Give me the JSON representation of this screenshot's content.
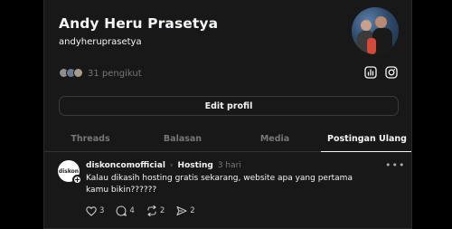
{
  "profile": {
    "name": "Andy Heru Prasetya",
    "handle": "andyheruprasetya",
    "followers_text": "31 pengikut"
  },
  "actions": {
    "edit_profile": "Edit profil"
  },
  "tabs": [
    {
      "label": "Threads",
      "active": false
    },
    {
      "label": "Balasan",
      "active": false
    },
    {
      "label": "Media",
      "active": false
    },
    {
      "label": "Postingan Ulang",
      "active": true
    }
  ],
  "post": {
    "avatar_text": "diskon",
    "username": "diskoncomofficial",
    "topic": "Hosting",
    "time": "3 hari",
    "text": "Kalau dikasih hosting gratis sekarang, website apa yang pertama kamu bikin??????",
    "likes": "3",
    "comments": "4",
    "reposts": "2",
    "shares": "2"
  },
  "icons": {
    "insights": "bar-chart-icon",
    "instagram": "instagram-icon",
    "more": "more-horizontal-icon",
    "like": "heart-icon",
    "comment": "comment-icon",
    "repost": "repost-icon",
    "share": "send-icon"
  },
  "colors": {
    "background": "#000000",
    "card": "#181818",
    "text_primary": "#f3f5f7",
    "text_secondary": "#777777",
    "border": "#333333"
  }
}
